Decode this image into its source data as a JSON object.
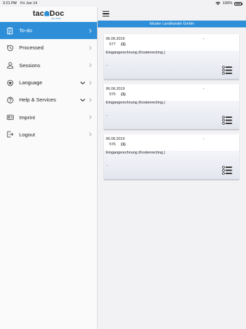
{
  "status_bar": {
    "time": "3:21 PM",
    "date": "Fri Jun 14",
    "battery": "100%",
    "battery_level": 1.0
  },
  "logo": {
    "part1": "tac",
    "part2": "Doc",
    "sub": "by Lexal"
  },
  "sidebar": {
    "items": [
      {
        "label": "To-do",
        "icon": "todo-list-icon",
        "active": true,
        "expandable": false
      },
      {
        "label": "Processed",
        "icon": "history-clock-icon",
        "active": false,
        "expandable": false
      },
      {
        "label": "Sessions",
        "icon": "user-session-icon",
        "active": false,
        "expandable": false
      },
      {
        "label": "Language",
        "icon": "language-flag-icon",
        "active": false,
        "expandable": true
      },
      {
        "label": "Help & Services",
        "icon": "help-circle-icon",
        "active": false,
        "expandable": true
      },
      {
        "label": "Imprint",
        "icon": "id-card-icon",
        "active": false,
        "expandable": false
      },
      {
        "label": "Logout",
        "icon": "logout-icon",
        "active": false,
        "expandable": false
      }
    ]
  },
  "main": {
    "company": "Muster Landhandel GmbH",
    "cards": [
      {
        "date": "06.06.2019",
        "dash": "-",
        "number": "577",
        "count": "(1)",
        "doc_type": "Eingangsrechnung (Kostenrechng.)",
        "detail": "-"
      },
      {
        "date": "06.06.2019",
        "dash": "-",
        "number": "575",
        "count": "(1)",
        "doc_type": "Eingangsrechnung (Kostenrechng.)",
        "detail": "-"
      },
      {
        "date": "06.06.2019",
        "dash": "-",
        "number": "576",
        "count": "(1)",
        "doc_type": "Eingangsrechnung (Kostenrechng.)",
        "detail": "-"
      }
    ]
  },
  "colors": {
    "accent": "#2e8fd8",
    "background": "#f2f2f4",
    "sidebar": "#fafafa"
  }
}
